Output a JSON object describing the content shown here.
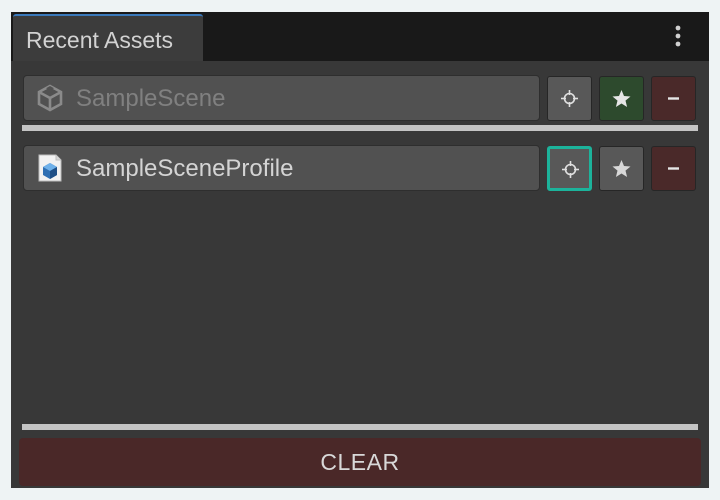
{
  "window": {
    "tab_title": "Recent Assets",
    "menu_icon": "vertical-ellipsis-icon"
  },
  "assets": [
    {
      "name": "SampleScene",
      "icon": "unity-scene-icon",
      "dimmed": true,
      "locate_icon": "crosshair-icon",
      "favorite_icon": "star-icon",
      "favorite_active": true,
      "remove_icon": "minus-icon"
    },
    {
      "name": "SampleSceneProfile",
      "icon": "scriptable-object-icon",
      "dimmed": false,
      "locate_icon": "crosshair-icon",
      "locate_focused": true,
      "favorite_icon": "star-icon",
      "favorite_active": false,
      "remove_icon": "minus-icon"
    }
  ],
  "footer": {
    "clear_label": "CLEAR"
  },
  "colors": {
    "panel_background": "#383838",
    "tab_accent": "#3a79bb",
    "focus_outline": "#1cb39b",
    "favorite_active_bg": "#2d4a2d",
    "remove_bg": "#4a2929",
    "clear_bg": "#4a2828"
  }
}
